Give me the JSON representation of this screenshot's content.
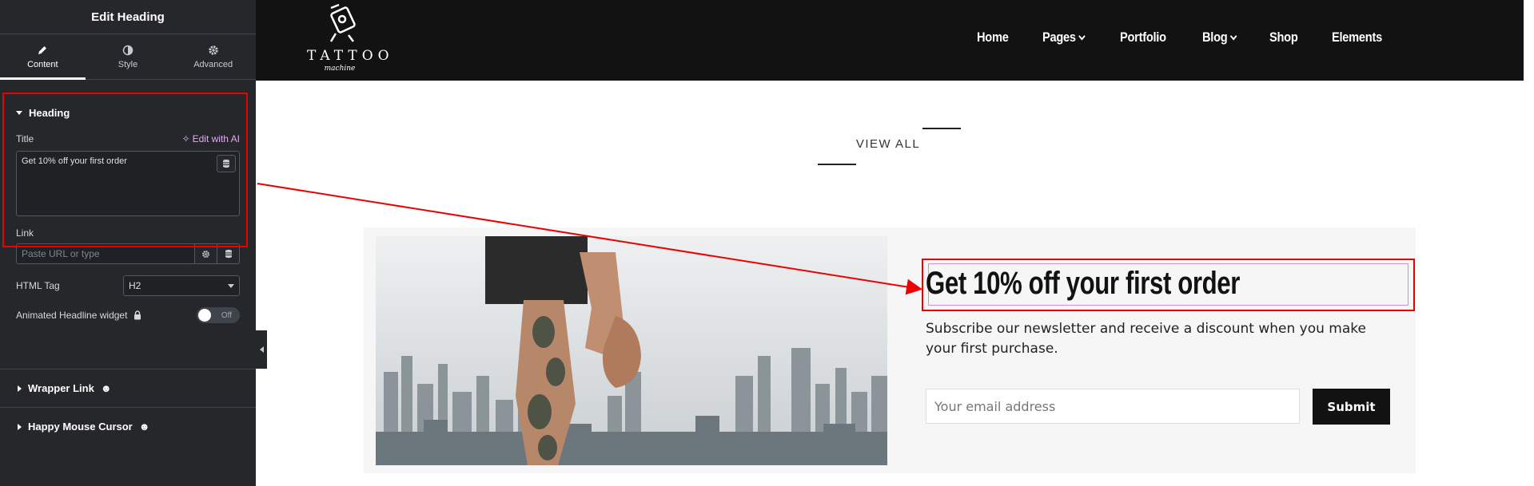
{
  "panel": {
    "title": "Edit Heading",
    "tabs": [
      {
        "label": "Content",
        "icon": "pencil-icon"
      },
      {
        "label": "Style",
        "icon": "half-circle-icon"
      },
      {
        "label": "Advanced",
        "icon": "gear-icon"
      }
    ],
    "heading_section": {
      "label": "Heading",
      "title_label": "Title",
      "ai_label": "Edit with AI",
      "title_value": "Get 10% off your first order",
      "link_label": "Link",
      "link_placeholder": "Paste URL or type",
      "html_tag_label": "HTML Tag",
      "html_tag_value": "H2",
      "animated_label": "Animated Headline widget",
      "toggle_label": "Off"
    },
    "collapsed_sections": [
      {
        "label": "Wrapper Link"
      },
      {
        "label": "Happy Mouse Cursor"
      }
    ]
  },
  "site": {
    "logo_text": "TATTOO",
    "logo_script": "machine",
    "nav": [
      {
        "label": "Home",
        "has_dropdown": false
      },
      {
        "label": "Pages",
        "has_dropdown": true
      },
      {
        "label": "Portfolio",
        "has_dropdown": false
      },
      {
        "label": "Blog",
        "has_dropdown": true
      },
      {
        "label": "Shop",
        "has_dropdown": false
      },
      {
        "label": "Elements",
        "has_dropdown": false
      }
    ],
    "view_all": "VIEW ALL"
  },
  "newsletter": {
    "heading": "Get 10% off your first order",
    "text": "Subscribe our newsletter and receive a discount when you make your first purchase.",
    "email_placeholder": "Your email address",
    "submit_label": "Submit"
  },
  "colors": {
    "panel_bg": "#26272b",
    "header_bg": "#121212",
    "annotation_red": "#e00000",
    "ai_accent": "#e4a9f5"
  }
}
